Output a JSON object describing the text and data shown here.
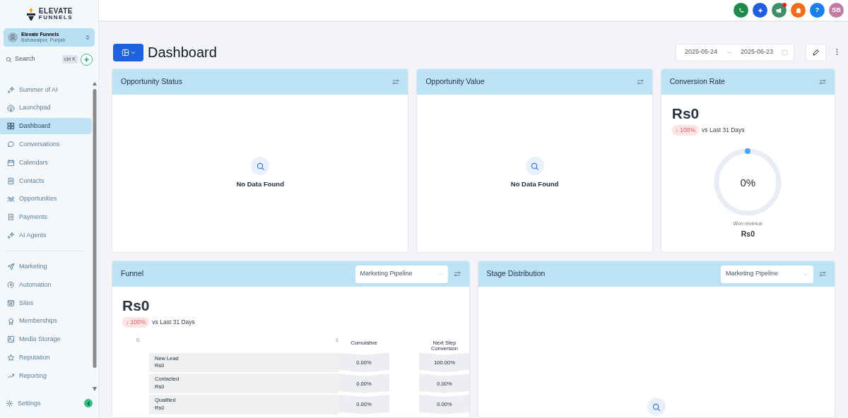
{
  "logo": {
    "line_1": "ELEVATE",
    "line_2": "FUNNELS"
  },
  "account": {
    "name": "Elevate Funnels",
    "location": "Bahawalpur, Punjab"
  },
  "search": {
    "label": "Search",
    "shortcut": "ctrl K"
  },
  "sidebar": {
    "groups": [
      {
        "items": [
          {
            "label": "Summer of AI",
            "selected": false
          },
          {
            "label": "Launchpad",
            "selected": false
          },
          {
            "label": "Dashboard",
            "selected": true
          },
          {
            "label": "Conversations",
            "selected": false
          },
          {
            "label": "Calendars",
            "selected": false
          },
          {
            "label": "Contacts",
            "selected": false
          },
          {
            "label": "Opportunities",
            "selected": false
          },
          {
            "label": "Payments",
            "selected": false
          },
          {
            "label": "AI Agents",
            "selected": false
          }
        ]
      },
      {
        "items": [
          {
            "label": "Marketing",
            "selected": false
          },
          {
            "label": "Automation",
            "selected": false
          },
          {
            "label": "Sites",
            "selected": false
          },
          {
            "label": "Memberships",
            "selected": false
          },
          {
            "label": "Media Storage",
            "selected": false
          },
          {
            "label": "Reputation",
            "selected": false
          },
          {
            "label": "Reporting",
            "selected": false
          }
        ]
      }
    ],
    "settings": "Settings"
  },
  "topbar": {
    "buttons": [
      {
        "kind": "phone",
        "color": "#1e8a4c",
        "badge": false
      },
      {
        "kind": "sparkle",
        "color": "#1f5fdc",
        "badge": false
      },
      {
        "kind": "megaphone",
        "color": "#3f8f6a",
        "badge": true
      },
      {
        "kind": "bell",
        "color": "#f26d1b",
        "badge": false
      },
      {
        "kind": "help",
        "color": "#1e7ee8",
        "badge": false,
        "text": "?"
      },
      {
        "kind": "avatar",
        "color": "#c27aa6",
        "badge": false,
        "text": "SB"
      }
    ]
  },
  "header": {
    "title": "Dashboard",
    "date_from": "2025-05-24",
    "date_arrow": "→",
    "date_to": "2025-06-23"
  },
  "widgets": [
    {
      "kind": "empty",
      "title": "Opportunity Status",
      "message": "No Data Found"
    },
    {
      "kind": "empty",
      "title": "Opportunity Value",
      "message": "No Data Found"
    },
    {
      "kind": "rate",
      "title": "Conversion Rate",
      "value": "Rs0",
      "change": "↓ 100%",
      "comparison": "vs Last 31 Days",
      "percent": "0%",
      "caption": "Won revenue",
      "caption_value": "Rs0"
    },
    {
      "kind": "funnel",
      "title": "Funnel",
      "pipeline": "Marketing Pipeline",
      "value": "Rs0",
      "change": "↓ 100%",
      "comparison": "vs Last 31 Days",
      "axis_start": "0",
      "axis_end": "1",
      "columns": [
        "Cumulative",
        "Next Step Conversion"
      ],
      "rows": [
        {
          "stage": "New Lead",
          "amount": "Rs0",
          "cumulative": "0.00%",
          "next_step": "100.00%"
        },
        {
          "stage": "Contacted",
          "amount": "Rs0",
          "cumulative": "0.00%",
          "next_step": "0.00%"
        },
        {
          "stage": "Qualified",
          "amount": "Rs0",
          "cumulative": "0.00%",
          "next_step": "0.00%"
        }
      ]
    },
    {
      "kind": "stages",
      "title": "Stage Distribution",
      "pipeline": "Marketing Pipeline"
    }
  ]
}
